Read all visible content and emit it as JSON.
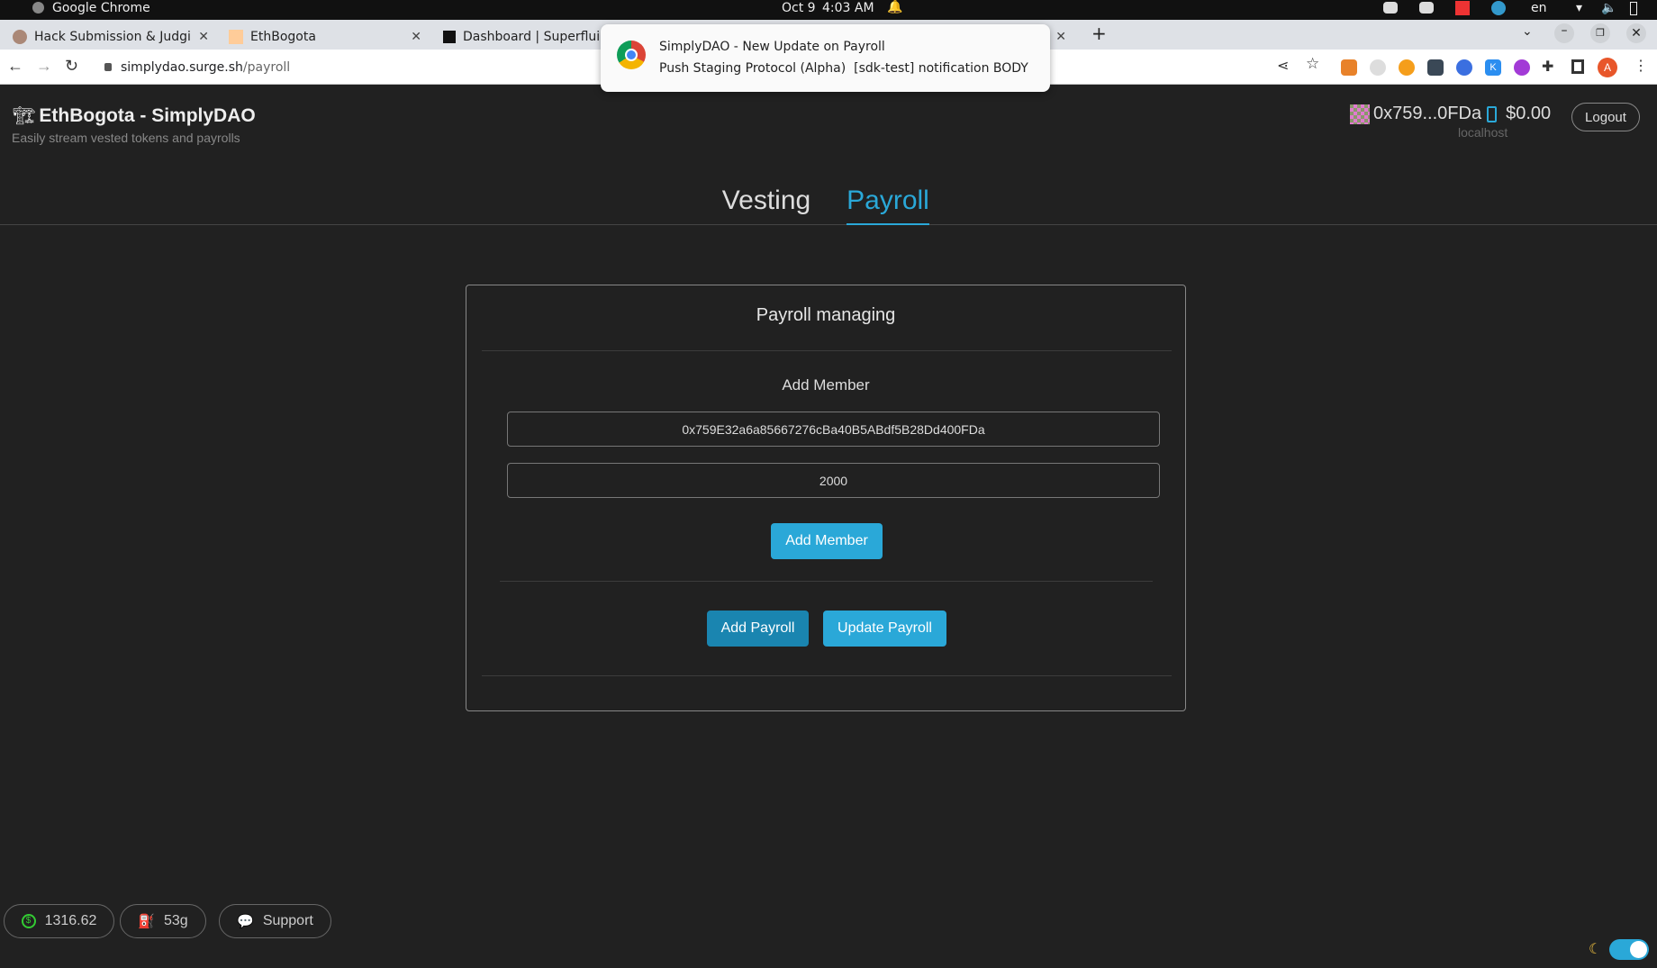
{
  "os": {
    "app_name": "Google Chrome",
    "date": "Oct 9",
    "time": "4:03 AM",
    "lang": "en"
  },
  "browser": {
    "tabs": [
      {
        "label": "Hack Submission & Judgi"
      },
      {
        "label": "EthBogota"
      },
      {
        "label": "Dashboard | Superflui"
      }
    ],
    "url_host": "simplydao.surge.sh",
    "url_path": "/payroll",
    "profile_initial": "A"
  },
  "notification": {
    "title": "SimplyDAO - New Update on Payroll",
    "body": "Push Staging Protocol (Alpha)  [sdk-test] notification BODY"
  },
  "header": {
    "title": "EthBogota - SimplyDAO",
    "subtitle": "Easily stream vested tokens and payrolls",
    "wallet_address": "0x759...0FDa",
    "balance": "$0.00",
    "network": "localhost",
    "logout_label": "Logout"
  },
  "nav": {
    "tabs": [
      {
        "label": "Vesting",
        "active": false
      },
      {
        "label": "Payroll",
        "active": true
      }
    ]
  },
  "card": {
    "title": "Payroll managing",
    "section_label": "Add Member",
    "address_value": "0x759E32a6a85667276cBa40B5ABdf5B28Dd400FDa",
    "amount_value": "2000",
    "add_member_label": "Add Member",
    "add_payroll_label": "Add Payroll",
    "update_payroll_label": "Update Payroll"
  },
  "footer": {
    "price": "1316.62",
    "gas": "53g",
    "support_label": "Support",
    "dark_mode": true
  },
  "colors": {
    "accent": "#2aa8d8",
    "accent_dark": "#1a85b0",
    "background": "#212121"
  }
}
